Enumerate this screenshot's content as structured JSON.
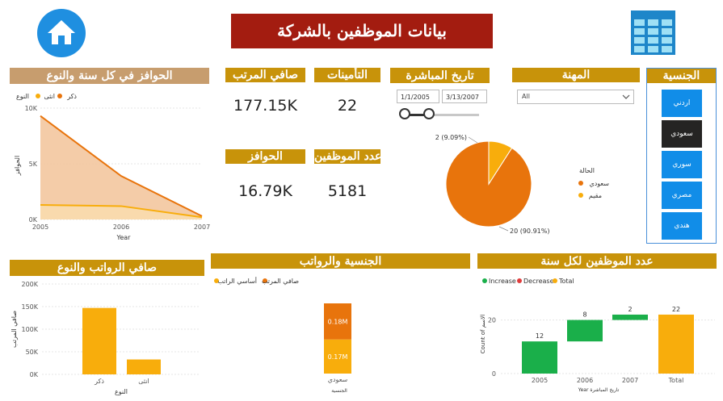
{
  "title": "بيانات الموظفين بالشركة",
  "icons": {
    "home": "home-icon",
    "table": "table-icon"
  },
  "colors": {
    "title_bg": "#a31c10",
    "header_gold": "#c8930a",
    "header_tan": "#c79d6e",
    "orange": "#e8740c",
    "amber": "#f8ad0c",
    "green": "#1aaf4a",
    "red": "#e03c3c",
    "nat_blue": "#118de8",
    "nat_dark": "#252423",
    "slicer_border": "#4a90d9"
  },
  "kpis": {
    "net_salary": {
      "label": "صافي المرتب",
      "value": "177.15K"
    },
    "insurance": {
      "label": "التأمينات",
      "value": "22"
    },
    "incentives": {
      "label": "الحوافز",
      "value": "16.79K"
    },
    "employees": {
      "label": "عدد الموظفين",
      "value": "5181"
    }
  },
  "date_slicer": {
    "title": "تاريخ المباشرة",
    "start": "1/1/2005",
    "end": "3/13/2007"
  },
  "job_slicer": {
    "title": "المهنة",
    "value": "All"
  },
  "nationality_slicer": {
    "title": "الجنسية",
    "items": [
      "اردني",
      "سعودي",
      "سوري",
      "مصري",
      "هندي"
    ],
    "selected": "سعودي"
  },
  "chart_data": [
    {
      "type": "area",
      "title": "الحوافز في كل سنة والنوع",
      "legend_title": "النوع",
      "x": [
        2005,
        2006,
        2007
      ],
      "xlabel": "Year",
      "ylabel": "الحوافز",
      "yticks": [
        "0K",
        "5K",
        "10K"
      ],
      "ylim": [
        0,
        10000
      ],
      "series": [
        {
          "name": "ذكر",
          "values": [
            9300,
            3900,
            300
          ]
        },
        {
          "name": "انثى",
          "values": [
            1300,
            1200,
            200
          ]
        }
      ]
    },
    {
      "type": "pie",
      "legend_title": "الحالة",
      "slices": [
        {
          "name": "سعودي",
          "value": 20,
          "label": "20 (90.91%)"
        },
        {
          "name": "مقيم",
          "value": 2,
          "label": "2 (9.09%)"
        }
      ]
    },
    {
      "type": "bar",
      "title": "صافي الرواتب والنوع",
      "categories": [
        "ذكر",
        "انثى"
      ],
      "values": [
        147000,
        33000
      ],
      "xlabel": "النوع",
      "ylabel": "صافي المرتب",
      "yticks": [
        "0K",
        "50K",
        "100K",
        "150K",
        "200K"
      ],
      "ylim": [
        0,
        200000
      ]
    },
    {
      "type": "bar",
      "title": "الجنسية والرواتب",
      "stacked": true,
      "categories": [
        "سعودي"
      ],
      "xlabel": "الجنسية",
      "series": [
        {
          "name": "صافي المرتب",
          "values": [
            0.18
          ],
          "label": "0.18M"
        },
        {
          "name": "أساسي الراتب",
          "values": [
            0.17
          ],
          "label": "0.17M"
        }
      ]
    },
    {
      "type": "bar",
      "subtype": "waterfall",
      "title": "عدد الموظفين لكل سنة",
      "legend": [
        "Increase",
        "Decrease",
        "Total"
      ],
      "categories": [
        "2005",
        "2006",
        "2007",
        "Total"
      ],
      "values": [
        12,
        8,
        2,
        22
      ],
      "xlabel": "Year تاريخ المباشرة",
      "ylabel": "Count of الاسم",
      "yticks": [
        "0",
        "20"
      ],
      "ylim": [
        0,
        28
      ]
    }
  ]
}
